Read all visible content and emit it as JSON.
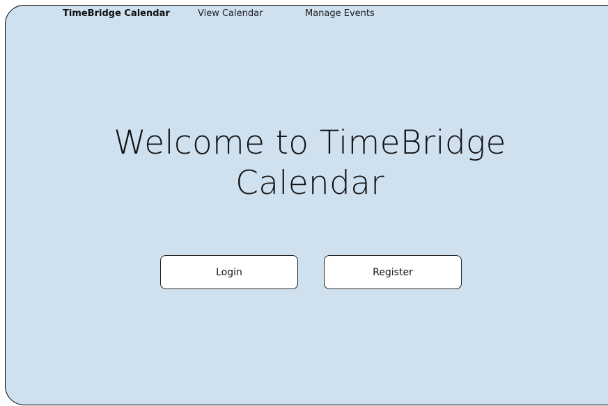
{
  "nav": {
    "brand": "TimeBridge Calendar",
    "links": [
      {
        "label": "View Calendar"
      },
      {
        "label": "Manage Events"
      }
    ]
  },
  "hero": {
    "title_line1": "Welcome to TimeBridge",
    "title_line2": "Calendar"
  },
  "actions": {
    "login_label": "Login",
    "register_label": "Register"
  },
  "colors": {
    "background": "#cfe0ef",
    "button_bg": "#ffffff",
    "border": "#000000"
  }
}
